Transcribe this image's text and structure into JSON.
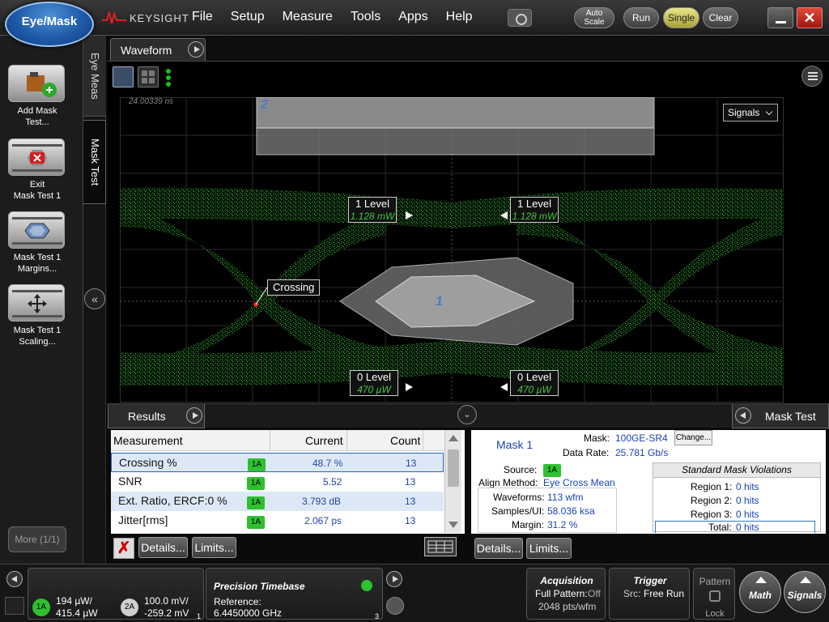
{
  "app": {
    "mode_button": "Eye/Mask",
    "brand": "KEYSIGHT"
  },
  "menu": [
    "File",
    "Setup",
    "Measure",
    "Tools",
    "Apps",
    "Help"
  ],
  "toolbar": {
    "auto_scale_1": "Auto",
    "auto_scale_2": "Scale",
    "run": "Run",
    "single": "Single",
    "clear": "Clear",
    "close": "✕"
  },
  "left_panel": {
    "buttons": [
      {
        "line1": "Add Mask",
        "line2": "Test..."
      },
      {
        "line1": "Exit",
        "line2": "Mask Test 1"
      },
      {
        "line1": "Mask Test 1",
        "line2": "Margins..."
      },
      {
        "line1": "Mask Test 1",
        "line2": "Scaling..."
      }
    ],
    "more": "More (1/1)",
    "tabs": {
      "eye_meas": "Eye Meas",
      "mask_test": "Mask Test"
    }
  },
  "waveform": {
    "tab": "Waveform",
    "timestamp": "24.00339 ns",
    "signals_dropdown": "Signals",
    "region_labels": {
      "r1": "1",
      "r2": "2"
    },
    "markers": [
      {
        "name": "1 Level",
        "value": "1.128 mW"
      },
      {
        "name": "1 Level",
        "value": "1.128 mW"
      },
      {
        "name": "0 Level",
        "value": "470 µW"
      },
      {
        "name": "0 Level",
        "value": "470 µW"
      }
    ],
    "crossing_label": "Crossing"
  },
  "results": {
    "tab": "Results",
    "columns": {
      "measurement": "Measurement",
      "current": "Current",
      "count": "Count"
    },
    "rows": [
      {
        "name": "Crossing %",
        "source": "1A",
        "current": "48.7 %",
        "count": "13"
      },
      {
        "name": "SNR",
        "source": "1A",
        "current": "5.52",
        "count": "13"
      },
      {
        "name": "Ext. Ratio, ERCF:0 %",
        "source": "1A",
        "current": "3.793 dB",
        "count": "13"
      },
      {
        "name": "Jitter[rms]",
        "source": "1A",
        "current": "2.067 ps",
        "count": "13"
      }
    ],
    "delete_icon": "✗",
    "details": "Details...",
    "limits": "Limits..."
  },
  "mask_test": {
    "tab": "Mask Test",
    "mask_name": "Mask 1",
    "mask_label": "Mask:",
    "mask_value": "100GE-SR4",
    "change_button": "Change...",
    "data_rate_label": "Data Rate:",
    "data_rate_value": "25.781 Gb/s",
    "source_label": "Source:",
    "source_value": "1A",
    "align_label": "Align Method:",
    "align_value": "Eye Cross Mean",
    "waveforms_label": "Waveforms:",
    "waveforms_value": "113 wfm",
    "samples_label": "Samples/UI:",
    "samples_value": "58.036 ksa",
    "margin_label": "Margin:",
    "margin_value": "31.2 %",
    "violations_title": "Standard Mask Violations",
    "regions": [
      {
        "label": "Region 1:",
        "value": "0 hits"
      },
      {
        "label": "Region 2:",
        "value": "0 hits"
      },
      {
        "label": "Region 3:",
        "value": "0 hits"
      }
    ],
    "total_label": "Total:",
    "total_value": "0 hits",
    "details": "Details...",
    "limits": "Limits..."
  },
  "status": {
    "ch1": {
      "badge": "1A",
      "line1": "194 µW/",
      "line2": "415.4 µW",
      "num": "1"
    },
    "ch2": {
      "badge": "2A",
      "line1": "100.0 mV/",
      "line2": "-259.2 mV"
    },
    "timebase": {
      "title": "Precision Timebase",
      "line1": "Reference:",
      "line2": "6.4450000 GHz",
      "num": "3"
    },
    "acquisition": {
      "title": "Acquisition",
      "line1a": "Full Pattern:",
      "line1b": "Off",
      "line2": "2048 pts/wfm"
    },
    "trigger": {
      "title": "Trigger",
      "line1a": "Src:",
      "line1b": "Free Run"
    },
    "pattern": {
      "title": "Pattern",
      "lock": "Lock"
    },
    "math": "Math",
    "signals": "Signals"
  },
  "colors": {
    "accent_blue": "#1e5aa8",
    "trace_green": "#2ec02e",
    "single_yellow": "#d9d46a"
  }
}
